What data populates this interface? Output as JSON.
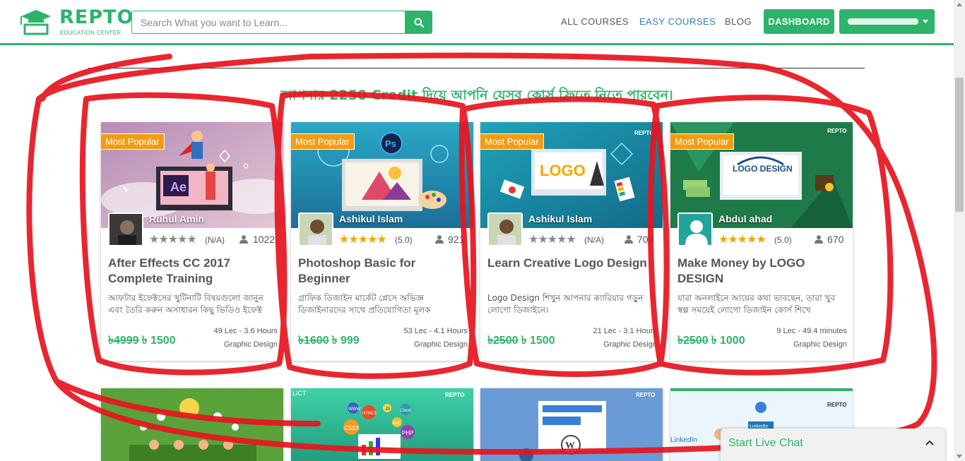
{
  "header": {
    "logo_text": "REPTO",
    "logo_subtitle": "EDUCATION CENTER",
    "search_placeholder": "Search What you want to Learn...",
    "nav": [
      "ALL COURSES",
      "EASY COURSES",
      "BLOG"
    ],
    "dashboard_label": "DASHBOARD"
  },
  "heading": "আপনার 2250 Credit দিয়ে আপনি যেসব কোর্স ফ্রিতে নিতে পারবেন।",
  "courses": [
    {
      "badge": "Most Popular",
      "instructor": "Ruhul Amin",
      "rating": "(N/A)",
      "students": "1022",
      "title": "After Effects CC 2017 Complete Training",
      "desc": "আফটার ইফেক্টসের খুটিনাটি বিষয়গুলো জানুন এবং তৈরি করুন অসাধারন কিছু ভিডিও ইফেক্ট",
      "old_price": "৳4999",
      "price": "৳ 1500",
      "lectures": "49 Lec - 3.6 Hours",
      "category": "Graphic Design",
      "stars_filled": 0
    },
    {
      "badge": "Most Popular",
      "instructor": "Ashikul Islam",
      "rating": "(5.0)",
      "students": "921",
      "title": "Photoshop Basic for Beginner",
      "desc": "গ্রাফিক ডিজাইন মার্কেট প্লেসে অভিজ্ঞ ডিজাইনারদের সাথে প্রতিযোগিতা মূলক",
      "old_price": "৳1600",
      "price": "৳ 999",
      "lectures": "53 Lec - 4.1 Hours",
      "category": "Graphic Design",
      "stars_filled": 5
    },
    {
      "badge": "Most Popular",
      "instructor": "Ashikul Islam",
      "rating": "(N/A)",
      "students": "709",
      "title": "Learn Creative Logo Design",
      "desc": "Logo Design শিখুন আপনার ক্যারিয়ার গড়ুন লোগো ডিজাইনে।",
      "old_price": "৳2500",
      "price": "৳ 1500",
      "lectures": "21 Lec - 3.1 Hours",
      "category": "Graphic Design",
      "stars_filled": 0
    },
    {
      "badge": "Most Popular",
      "instructor": "Abdul ahad",
      "rating": "(5.0)",
      "students": "670",
      "title": "Make Money by LOGO DESIGN",
      "desc": "যারা অনলাইনে আয়ের কথা ভাবছেন, তারা খুব স্বল্প সময়েই লোগো ডিজাইন কোর্স শিখে",
      "old_price": "৳2500",
      "price": "৳ 1000",
      "lectures": "9 Lec - 49.4 minutes",
      "category": "Graphic Design",
      "stars_filled": 5
    }
  ],
  "thumb_texts": {
    "ps": "Ps",
    "ae": "Ae",
    "logo_word": "LOGO",
    "logo_design": "LOGO DESIGN",
    "repto": "REPTO",
    "css": "CSS3",
    "html": "HTML5",
    "php": "PHP",
    "xml": "XML",
    "js": "JS",
    "cloud": "Cloud",
    "www": "WWW",
    "linkedin": "LinkedIn",
    "lict": "LICT"
  },
  "live_chat": "Start Live Chat",
  "colors": {
    "brand": "#2eb36b",
    "badge": "#f39c12",
    "star": "#f0a500",
    "annotation": "#e8141e"
  }
}
